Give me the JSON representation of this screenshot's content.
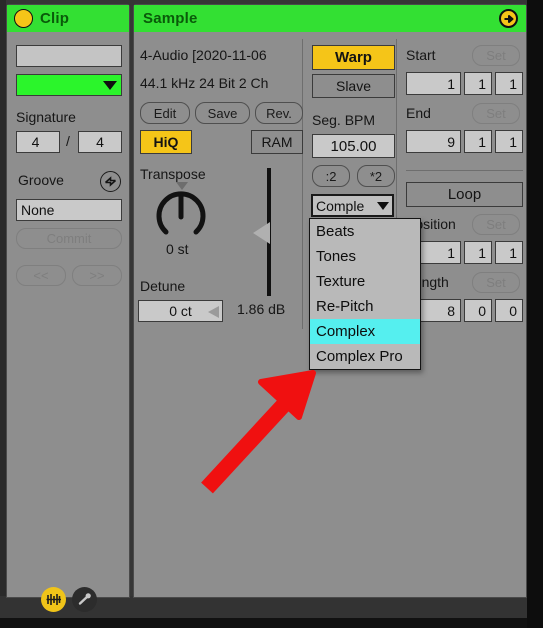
{
  "window": {
    "background_color": "#363636",
    "panel_color": "#8e8e8e",
    "header_color": "#33e033",
    "accent_yellow": "#f5c518",
    "highlight_cyan": "#55efef",
    "annotation_color": "#ff1a1a"
  },
  "clip_panel": {
    "title": "Clip",
    "power_icon": "clip-activator-circle",
    "name_value": "",
    "name_placeholder": "",
    "color_value": "#2bf52b",
    "color_caret_icon": "chevron-down-icon",
    "signature_label": "Signature",
    "signature_numerator": "4",
    "signature_separator": "/",
    "signature_denominator": "4",
    "groove_label": "Groove",
    "groove_icon": "groove-refresh-icon",
    "groove_value": "None",
    "commit_label": "Commit",
    "prev_label": "<<",
    "next_label": ">>"
  },
  "sample_panel": {
    "title": "Sample",
    "header_arrow_icon": "arrow-right-circle-icon",
    "file_name": "4-Audio [2020-11-06",
    "file_info": "44.1 kHz 24 Bit 2 Ch",
    "edit_label": "Edit",
    "save_label": "Save",
    "reverse_label": "Rev.",
    "hiq_label": "HiQ",
    "ram_label": "RAM",
    "transpose_label": "Transpose",
    "transpose_value": "0 st",
    "detune_label": "Detune",
    "detune_value": "0 ct",
    "gain_value": "1.86 dB"
  },
  "warp_section": {
    "warp_label": "Warp",
    "sync_mode_label": "Slave",
    "seg_bpm_label": "Seg. BPM",
    "seg_bpm_value": "105.00",
    "halve_label": ":2",
    "double_label": "*2",
    "warp_mode_value": "Comple",
    "warp_mode_caret_icon": "chevron-down-icon",
    "warp_mode_options": [
      "Beats",
      "Tones",
      "Texture",
      "Re-Pitch",
      "Complex",
      "Complex Pro"
    ],
    "warp_mode_selected_index": 4
  },
  "region_section": {
    "start_label": "Start",
    "start_set_label": "Set",
    "start_bars": "1",
    "start_beats": "1",
    "start_sixteenths": "1",
    "end_label": "End",
    "end_set_label": "Set",
    "end_bars": "9",
    "end_beats": "1",
    "end_sixteenths": "1",
    "loop_label": "Loop",
    "position_label": "Position",
    "position_set_label": "Set",
    "position_bars": "1",
    "position_beats": "1",
    "position_sixteenths": "1",
    "length_label": "Length",
    "length_set_label": "Set",
    "length_bars": "8",
    "length_beats": "0",
    "length_sixteenths": "0"
  },
  "bottom_bar": {
    "envelope_icon": "envelopes-icon",
    "modulation_icon": "modulation-icon"
  }
}
